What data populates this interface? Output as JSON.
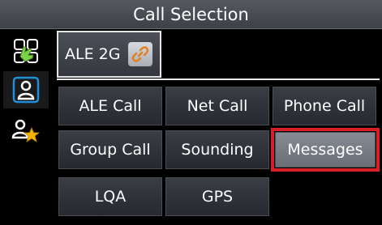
{
  "header": {
    "title": "Call Selection"
  },
  "sidebar": {
    "items": [
      {
        "icon": "waving-hand-radio-icon"
      },
      {
        "icon": "single-user-icon"
      },
      {
        "icon": "favorite-user-icon"
      }
    ]
  },
  "selector": {
    "label": "ALE 2G",
    "icon": "link-icon"
  },
  "buttons": [
    {
      "label": "ALE Call"
    },
    {
      "label": "Net Call"
    },
    {
      "label": "Phone Call"
    },
    {
      "label": "Group Call"
    },
    {
      "label": "Sounding"
    },
    {
      "label": "Messages"
    },
    {
      "label": "LQA"
    },
    {
      "label": "GPS"
    }
  ],
  "colors": {
    "accent": "#1e8fd8",
    "selection": "#d81e27",
    "star": "#f4b400"
  }
}
